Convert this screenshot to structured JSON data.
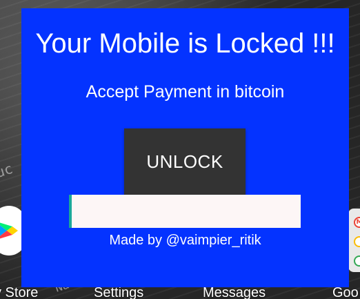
{
  "lock_screen": {
    "title": "Your Mobile is Locked !!!",
    "subtitle": "Accept Payment in bitcoin",
    "unlock_button_label": "UNLOCK",
    "code_input_value": "",
    "credit": "Made by @vaimpier_ritik",
    "background_color": "#0433ff",
    "button_color": "#333333"
  },
  "home_screen": {
    "apps": [
      {
        "label": "y Store",
        "icon": "play-store-icon"
      },
      {
        "label": "Settings",
        "icon": "settings-icon"
      },
      {
        "label": "Messages",
        "icon": "messages-icon"
      },
      {
        "label": "Goo",
        "icon": "google-folder-icon"
      }
    ],
    "google_folder": {
      "mini_apps": [
        "gmail-icon",
        "google-drive-icon",
        "chrome-icon"
      ],
      "mini_app_letters": [
        "M",
        "",
        ""
      ]
    },
    "wallpaper_text": [
      "uc",
      "Na",
      "M"
    ]
  }
}
